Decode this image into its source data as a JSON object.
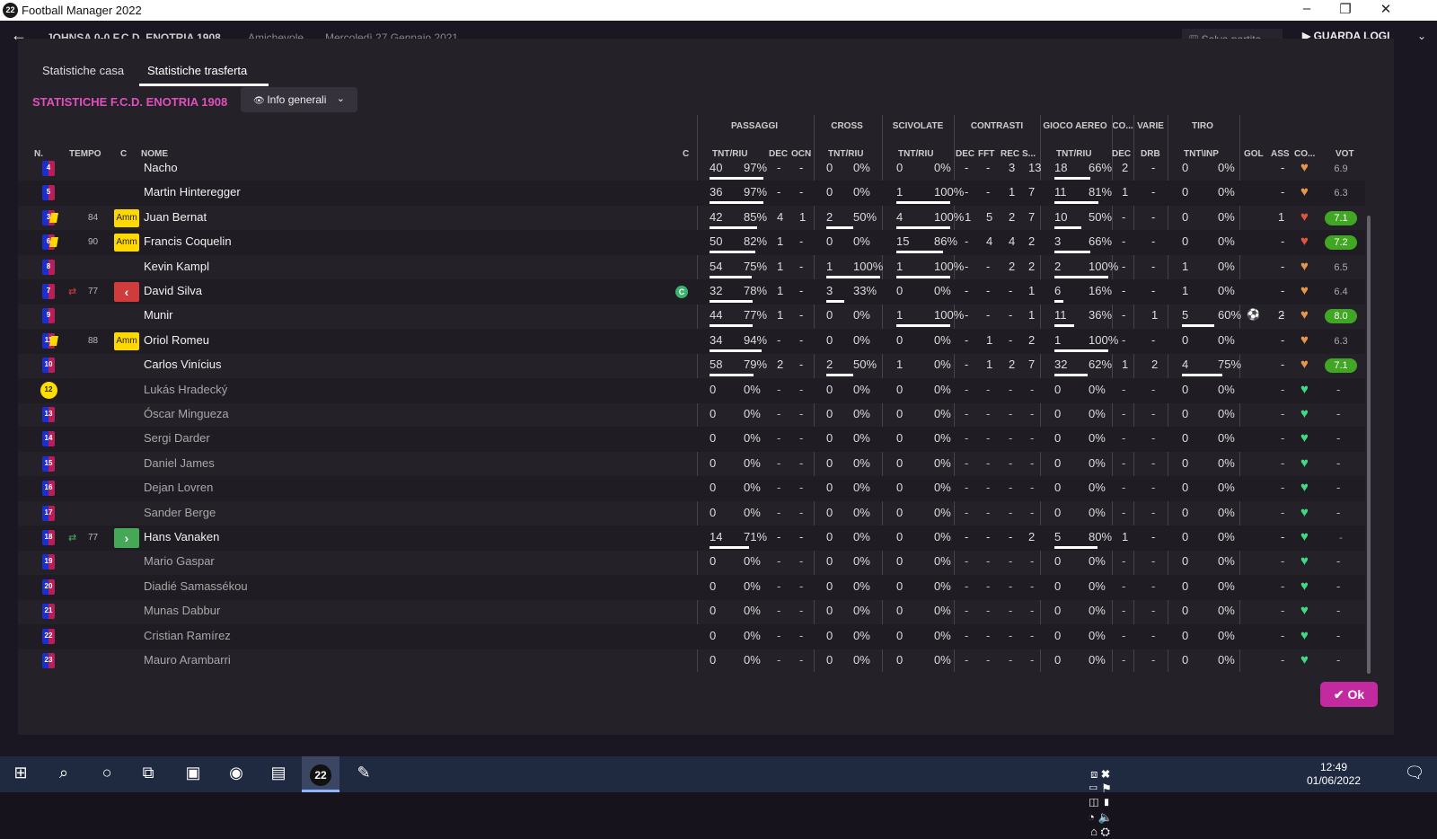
{
  "app": {
    "title": "Football Manager 2022",
    "icon_label": "22"
  },
  "topbar": {
    "match": "JOHNSA 0-0 F.C.D. ENOTRIA 1908",
    "match_type": "Amichevole",
    "date": "Mercoledì 27 Gennaio 2021",
    "save_label": "Salva partita",
    "play_label": "GUARDA LOGI"
  },
  "tabs": [
    {
      "label": "Statistiche casa"
    },
    {
      "label": "Statistiche trasferta"
    }
  ],
  "section_title": "STATISTICHE F.C.D. ENOTRIA 1908",
  "view_dropdown": {
    "label": "Info generali"
  },
  "groups": [
    "PASSAGGI",
    "CROSS",
    "SCIVOLATE",
    "CONTRASTI",
    "GIOCO AEREO",
    "CO...",
    "VARIE",
    "TIRO"
  ],
  "headers": {
    "n": "N.",
    "tempo": "TEMPO",
    "c": "C",
    "nome": "NOME",
    "c2": "C",
    "pas_tnt": "TNT/RIU",
    "pas_dec": "DEC",
    "pas_ocn": "OCN",
    "cross": "TNT/RIU",
    "sciv": "TNT/RIU",
    "con_dec": "DEC",
    "con_fft": "FFT",
    "con_rec": "REC",
    "con_s": "S...",
    "aereo": "TNT/RIU",
    "co_dec": "DEC",
    "drb": "DRB",
    "tiro": "TNT\\INP",
    "gol": "GOL",
    "ass": "ASS",
    "co": "CO...",
    "vot": "VOT"
  },
  "players": [
    {
      "n": "4",
      "name": "Nacho",
      "tempo": "",
      "card": false,
      "badge": "",
      "pas": [
        "40",
        "97%"
      ],
      "pdec": "-",
      "pocn": "-",
      "cross": [
        "0",
        "0%"
      ],
      "sciv": [
        "0",
        "0%"
      ],
      "cdec": "-",
      "cfft": "-",
      "crec": "3",
      "cs": "13",
      "aer": [
        "18",
        "66%"
      ],
      "codec": "2",
      "drb": "-",
      "tiro": [
        "0",
        "0%"
      ],
      "gol": "",
      "ass": "-",
      "vote": "6.9",
      "vgood": false,
      "heart": "orange",
      "bench": false
    },
    {
      "n": "5",
      "name": "Martin Hinteregger",
      "tempo": "",
      "card": false,
      "badge": "",
      "pas": [
        "36",
        "97%"
      ],
      "pdec": "-",
      "pocn": "-",
      "cross": [
        "0",
        "0%"
      ],
      "sciv": [
        "1",
        "100%"
      ],
      "cdec": "-",
      "cfft": "-",
      "crec": "1",
      "cs": "7",
      "aer": [
        "11",
        "81%"
      ],
      "codec": "1",
      "drb": "-",
      "tiro": [
        "0",
        "0%"
      ],
      "gol": "",
      "ass": "-",
      "vote": "6.3",
      "vgood": false,
      "heart": "orange",
      "bench": false
    },
    {
      "n": "3",
      "name": "Juan Bernat",
      "tempo": "84",
      "card": true,
      "badge": "Amm",
      "pas": [
        "42",
        "85%"
      ],
      "pdec": "4",
      "pocn": "1",
      "cross": [
        "2",
        "50%"
      ],
      "sciv": [
        "4",
        "100%"
      ],
      "cdec": "1",
      "cfft": "5",
      "crec": "2",
      "cs": "7",
      "aer": [
        "10",
        "50%"
      ],
      "codec": "-",
      "drb": "-",
      "tiro": [
        "0",
        "0%"
      ],
      "gol": "1",
      "ass": "",
      "vote": "7.1",
      "vgood": true,
      "heart": "red",
      "bench": false
    },
    {
      "n": "6",
      "name": "Francis Coquelin",
      "tempo": "90",
      "card": true,
      "badge": "Amm",
      "pas": [
        "50",
        "82%"
      ],
      "pdec": "1",
      "pocn": "-",
      "cross": [
        "0",
        "0%"
      ],
      "sciv": [
        "15",
        "86%"
      ],
      "cdec": "-",
      "cfft": "4",
      "crec": "4",
      "cs": "2",
      "aer": [
        "3",
        "66%"
      ],
      "codec": "-",
      "drb": "-",
      "tiro": [
        "0",
        "0%"
      ],
      "gol": "",
      "ass": "-",
      "vote": "7.2",
      "vgood": true,
      "heart": "red",
      "bench": false
    },
    {
      "n": "8",
      "name": "Kevin Kampl",
      "tempo": "",
      "card": false,
      "badge": "",
      "pas": [
        "54",
        "75%"
      ],
      "pdec": "1",
      "pocn": "-",
      "cross": [
        "1",
        "100%"
      ],
      "sciv": [
        "1",
        "100%"
      ],
      "cdec": "-",
      "cfft": "-",
      "crec": "2",
      "cs": "2",
      "aer": [
        "2",
        "100%"
      ],
      "codec": "-",
      "drb": "-",
      "tiro": [
        "1",
        "0%"
      ],
      "gol": "",
      "ass": "-",
      "vote": "6.5",
      "vgood": false,
      "heart": "orange",
      "bench": false
    },
    {
      "n": "7",
      "name": "David Silva",
      "tempo": "77",
      "card": false,
      "badge": "out",
      "pas": [
        "32",
        "78%"
      ],
      "pdec": "1",
      "pocn": "-",
      "cross": [
        "3",
        "33%"
      ],
      "sciv": [
        "0",
        "0%"
      ],
      "cdec": "-",
      "cfft": "-",
      "crec": "-",
      "cs": "1",
      "aer": [
        "6",
        "16%"
      ],
      "codec": "-",
      "drb": "-",
      "tiro": [
        "1",
        "0%"
      ],
      "gol": "",
      "ass": "-",
      "vote": "6.4",
      "vgood": false,
      "heart": "orange",
      "bench": false,
      "captain": "C"
    },
    {
      "n": "9",
      "name": "Munir",
      "tempo": "",
      "card": false,
      "badge": "",
      "pas": [
        "44",
        "77%"
      ],
      "pdec": "1",
      "pocn": "-",
      "cross": [
        "0",
        "0%"
      ],
      "sciv": [
        "1",
        "100%"
      ],
      "cdec": "-",
      "cfft": "-",
      "crec": "-",
      "cs": "1",
      "aer": [
        "11",
        "36%"
      ],
      "codec": "-",
      "drb": "1",
      "tiro": [
        "5",
        "60%"
      ],
      "gol": "2",
      "ass": "-",
      "vote": "8.0",
      "vgood": true,
      "heart": "orange",
      "bench": false,
      "goals": true
    },
    {
      "n": "11",
      "name": "Oriol Romeu",
      "tempo": "88",
      "card": true,
      "badge": "Amm",
      "pas": [
        "34",
        "94%"
      ],
      "pdec": "-",
      "pocn": "-",
      "cross": [
        "0",
        "0%"
      ],
      "sciv": [
        "0",
        "0%"
      ],
      "cdec": "-",
      "cfft": "1",
      "crec": "-",
      "cs": "2",
      "aer": [
        "1",
        "100%"
      ],
      "codec": "-",
      "drb": "-",
      "tiro": [
        "0",
        "0%"
      ],
      "gol": "",
      "ass": "-",
      "vote": "6.3",
      "vgood": false,
      "heart": "orange",
      "bench": false
    },
    {
      "n": "10",
      "name": "Carlos Vinícius",
      "tempo": "",
      "card": false,
      "badge": "",
      "pas": [
        "58",
        "79%"
      ],
      "pdec": "2",
      "pocn": "-",
      "cross": [
        "2",
        "50%"
      ],
      "sciv": [
        "1",
        "0%"
      ],
      "cdec": "-",
      "cfft": "1",
      "crec": "2",
      "cs": "7",
      "aer": [
        "32",
        "62%"
      ],
      "codec": "1",
      "drb": "2",
      "tiro": [
        "4",
        "75%"
      ],
      "gol": "",
      "ass": "-",
      "vote": "7.1",
      "vgood": true,
      "heart": "orange",
      "bench": false
    },
    {
      "n": "12",
      "name": "Lukás Hradecký",
      "gk": true,
      "bench": true
    },
    {
      "n": "13",
      "name": "Óscar Mingueza",
      "bench": true
    },
    {
      "n": "14",
      "name": "Sergi Darder",
      "bench": true
    },
    {
      "n": "15",
      "name": "Daniel James",
      "bench": true
    },
    {
      "n": "16",
      "name": "Dejan Lovren",
      "bench": true
    },
    {
      "n": "17",
      "name": "Sander Berge",
      "bench": true
    },
    {
      "n": "18",
      "name": "Hans Vanaken",
      "tempo": "77",
      "card": false,
      "badge": "in",
      "pas": [
        "14",
        "71%"
      ],
      "pdec": "-",
      "pocn": "-",
      "cross": [
        "0",
        "0%"
      ],
      "sciv": [
        "0",
        "0%"
      ],
      "cdec": "-",
      "cfft": "-",
      "crec": "-",
      "cs": "2",
      "aer": [
        "5",
        "80%"
      ],
      "codec": "1",
      "drb": "-",
      "tiro": [
        "0",
        "0%"
      ],
      "gol": "",
      "ass": "-",
      "vote": "-",
      "vgood": false,
      "heart": "green",
      "bench": false
    },
    {
      "n": "19",
      "name": "Mario Gaspar",
      "bench": true
    },
    {
      "n": "20",
      "name": "Diadié Samassékou",
      "bench": true
    },
    {
      "n": "21",
      "name": "Munas Dabbur",
      "bench": true
    },
    {
      "n": "22",
      "name": "Cristian Ramírez",
      "bench": true
    },
    {
      "n": "23",
      "name": "Mauro Arambarri",
      "bench": true
    }
  ],
  "ok_label": "Ok",
  "taskbar": {
    "time": "12:49",
    "date": "01/06/2022",
    "fm_label": "22"
  },
  "colors": {
    "accent": "#c42aa0",
    "title": "#e24fbd",
    "good": "#41a623"
  }
}
